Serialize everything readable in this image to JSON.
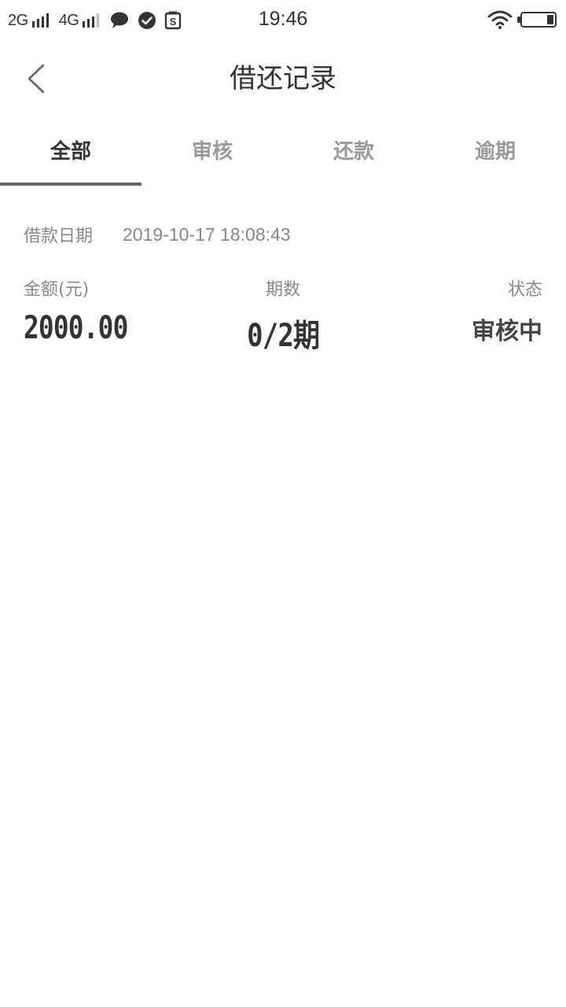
{
  "status_bar": {
    "network_1": "2G",
    "network_2": "4G",
    "time": "19:46",
    "icons": [
      "message-icon",
      "check-circle-icon",
      "sim-s-icon",
      "wifi-icon",
      "battery-icon"
    ]
  },
  "header": {
    "title": "借还记录",
    "back_icon": "chevron-left-icon"
  },
  "tabs": [
    {
      "label": "全部",
      "active": true
    },
    {
      "label": "审核",
      "active": false
    },
    {
      "label": "还款",
      "active": false
    },
    {
      "label": "逾期",
      "active": false
    }
  ],
  "record": {
    "date_label": "借款日期",
    "date_value": "2019-10-17 18:08:43",
    "amount_label": "金额(元)",
    "amount_value": "2000.00",
    "period_label": "期数",
    "period_value": "0/2期",
    "status_label": "状态",
    "status_value": "审核中"
  },
  "colors": {
    "text_primary": "#333333",
    "text_secondary": "#888888",
    "tab_inactive": "#9a9a9a",
    "tab_indicator": "#666666",
    "background": "#ffffff"
  }
}
